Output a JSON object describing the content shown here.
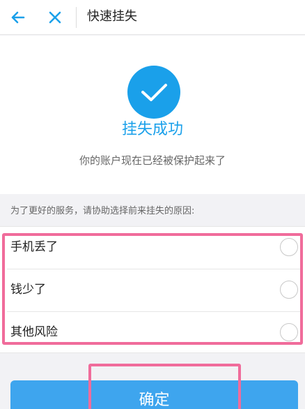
{
  "header": {
    "title": "快速挂失",
    "back_icon": "arrow-left-icon",
    "close_icon": "close-icon",
    "accent_color": "#1aa0ea"
  },
  "success": {
    "icon": "checkmark-icon",
    "title": "挂失成功",
    "subtitle": "你的账户现在已经被保护起来了"
  },
  "reason": {
    "prompt": "为了更好的服务，请协助选择前来挂失的原因:",
    "options": [
      {
        "label": "手机丢了",
        "selected": false
      },
      {
        "label": "钱少了",
        "selected": false
      },
      {
        "label": "其他风险",
        "selected": false
      }
    ]
  },
  "confirm": {
    "label": "确定",
    "color": "#3ea5ee"
  },
  "annotations": {
    "highlight_color": "#f06c9b"
  }
}
